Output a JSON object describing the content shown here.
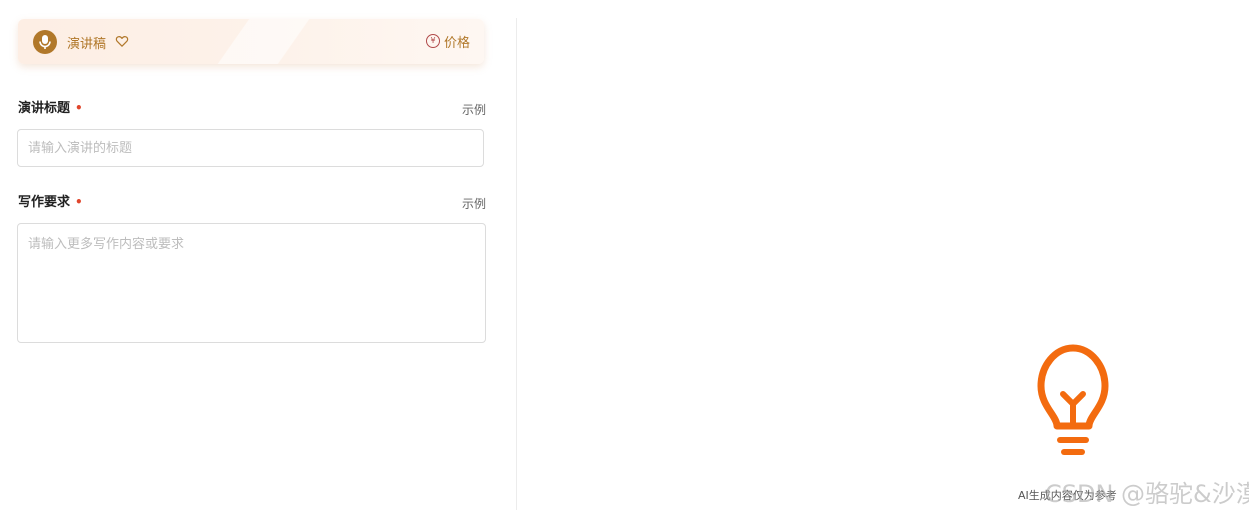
{
  "tool_card": {
    "icon": "microphone-icon",
    "name": "演讲稿",
    "favorite_icon": "heart-icon",
    "price_icon": "yen-icon",
    "price_icon_glyph": "¥",
    "price_label": "价格"
  },
  "form": {
    "title_field": {
      "label": "演讲标题",
      "required_mark": "•",
      "example_label": "示例",
      "value": "",
      "placeholder": "请输入演讲的标题"
    },
    "requirements_field": {
      "label": "写作要求",
      "required_mark": "•",
      "example_label": "示例",
      "value": "",
      "placeholder": "请输入更多写作内容或要求"
    }
  },
  "output_panel": {
    "icon": "lightbulb-icon",
    "disclaimer": "AI生成内容仅为参考",
    "watermark": "CSDN @骆驼&沙漠"
  },
  "colors": {
    "accent": "#b1782a",
    "bulb": "#f36b0f",
    "required": "#e0462c",
    "card_bg": "#fdeee4",
    "price_icon": "#b14a4a"
  }
}
